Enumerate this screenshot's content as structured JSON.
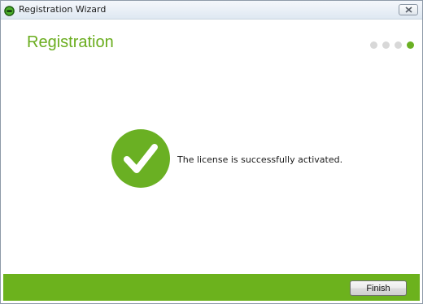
{
  "window": {
    "title": "Registration Wizard",
    "icon": "shield-app-icon",
    "close_icon": "close-icon"
  },
  "header": {
    "title": "Registration",
    "steps_total": 4,
    "current_step": 4
  },
  "content": {
    "status_icon": "checkmark-icon",
    "message": "The license is successfully activated."
  },
  "footer": {
    "finish_label": "Finish"
  },
  "colors": {
    "accent": "#6ab023",
    "title_green": "#6aad1e",
    "footer_bar": "#6cb21d",
    "step_inactive": "#d8d8d8"
  }
}
